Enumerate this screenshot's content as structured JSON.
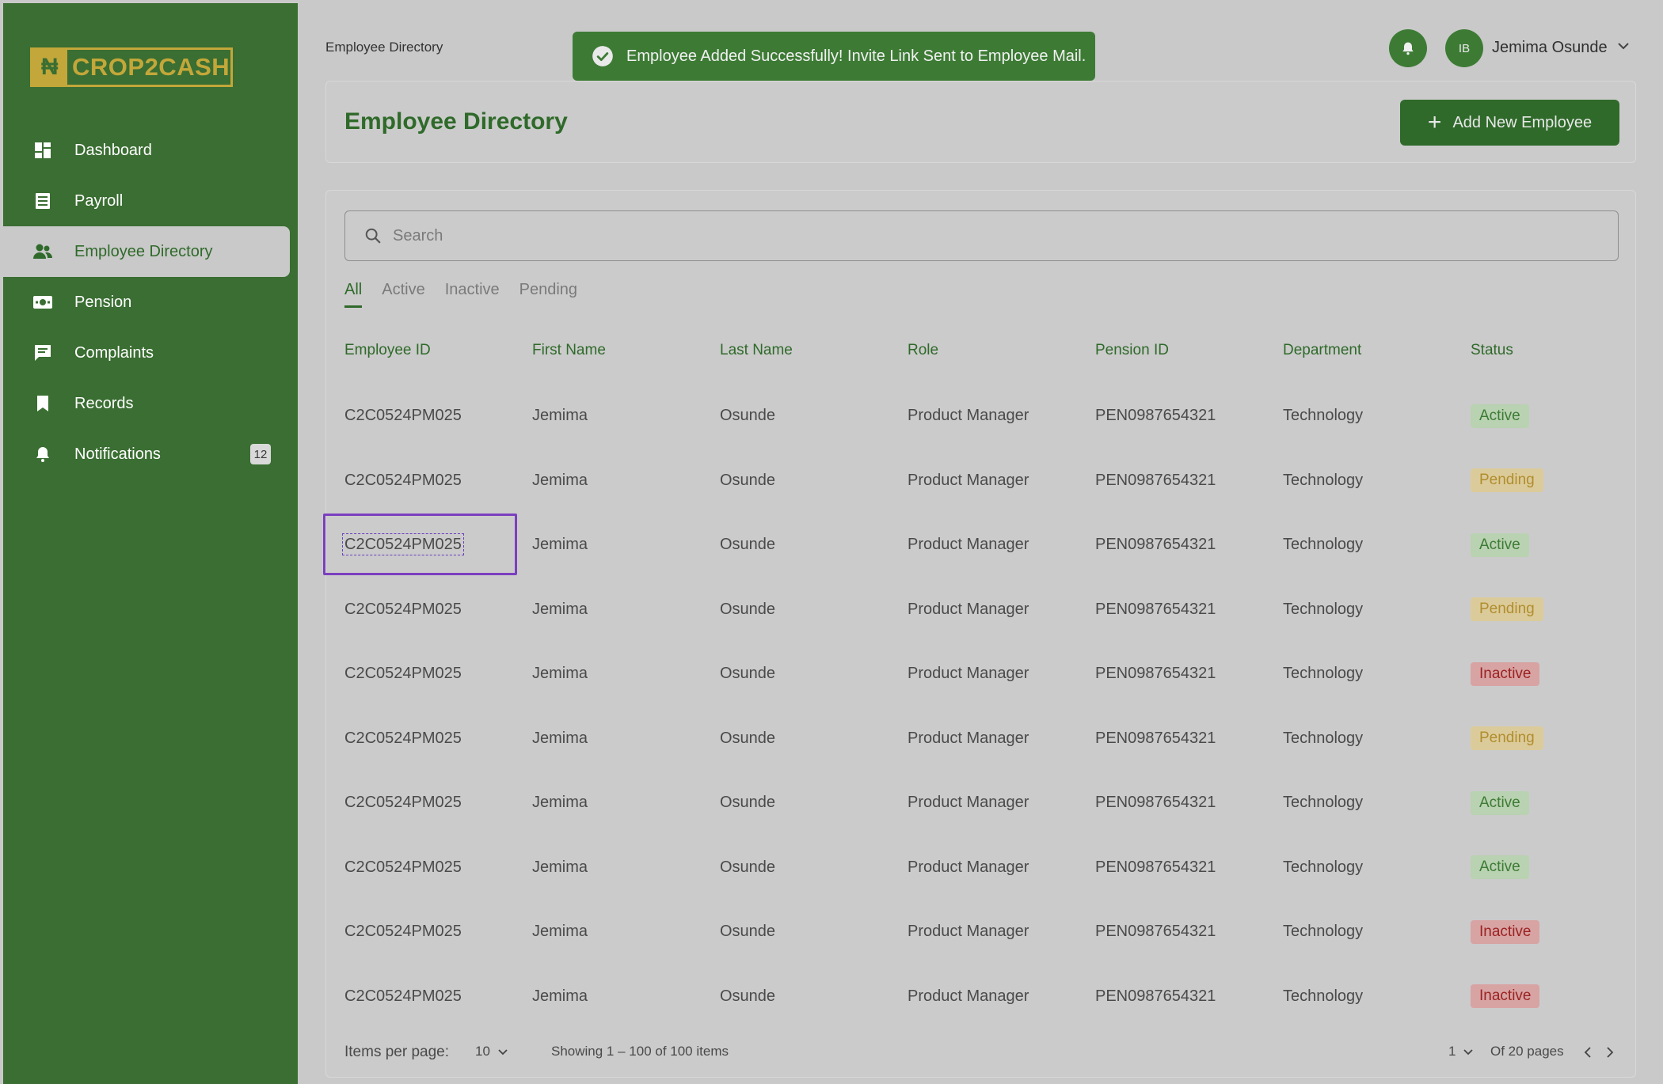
{
  "brand": {
    "logo_mark": "₦",
    "logo_text": "CROP2CASH"
  },
  "sidebar": {
    "items": [
      {
        "label": "Dashboard",
        "icon": "dashboard-icon"
      },
      {
        "label": "Payroll",
        "icon": "payroll-icon"
      },
      {
        "label": "Employee Directory",
        "icon": "users-icon",
        "active": true
      },
      {
        "label": "Pension",
        "icon": "pension-icon"
      },
      {
        "label": "Complaints",
        "icon": "complaints-icon"
      },
      {
        "label": "Records",
        "icon": "bookmark-icon"
      },
      {
        "label": "Notifications",
        "icon": "bell-icon",
        "badge": "12"
      }
    ]
  },
  "topbar": {
    "breadcrumb": "Employee Directory",
    "toast": "Employee Added Successfully! Invite Link Sent to Employee Mail.",
    "avatar_initials": "IB",
    "user_name": "Jemima Osunde"
  },
  "header": {
    "title": "Employee Directory",
    "add_button": "Add New Employee"
  },
  "search": {
    "placeholder": "Search"
  },
  "tabs": [
    "All",
    "Active",
    "Inactive",
    "Pending"
  ],
  "table": {
    "columns": [
      "Employee ID",
      "First Name",
      "Last Name",
      "Role",
      "Pension ID",
      "Department",
      "Status"
    ],
    "rows": [
      [
        "C2C0524PM025",
        "Jemima",
        "Osunde",
        "Product Manager",
        "PEN0987654321",
        "Technology",
        "Active"
      ],
      [
        "C2C0524PM025",
        "Jemima",
        "Osunde",
        "Product Manager",
        "PEN0987654321",
        "Technology",
        "Pending"
      ],
      [
        "C2C0524PM025",
        "Jemima",
        "Osunde",
        "Product Manager",
        "PEN0987654321",
        "Technology",
        "Active"
      ],
      [
        "C2C0524PM025",
        "Jemima",
        "Osunde",
        "Product Manager",
        "PEN0987654321",
        "Technology",
        "Pending"
      ],
      [
        "C2C0524PM025",
        "Jemima",
        "Osunde",
        "Product Manager",
        "PEN0987654321",
        "Technology",
        "Inactive"
      ],
      [
        "C2C0524PM025",
        "Jemima",
        "Osunde",
        "Product Manager",
        "PEN0987654321",
        "Technology",
        "Pending"
      ],
      [
        "C2C0524PM025",
        "Jemima",
        "Osunde",
        "Product Manager",
        "PEN0987654321",
        "Technology",
        "Active"
      ],
      [
        "C2C0524PM025",
        "Jemima",
        "Osunde",
        "Product Manager",
        "PEN0987654321",
        "Technology",
        "Active"
      ],
      [
        "C2C0524PM025",
        "Jemima",
        "Osunde",
        "Product Manager",
        "PEN0987654321",
        "Technology",
        "Inactive"
      ],
      [
        "C2C0524PM025",
        "Jemima",
        "Osunde",
        "Product Manager",
        "PEN0987654321",
        "Technology",
        "Inactive"
      ]
    ],
    "focused_row": 2
  },
  "footer": {
    "items_per_page_label": "Items per page:",
    "items_per_page": "10",
    "showing": "Showing 1 – 100 of 100 items",
    "current_page": "1",
    "page_total": "Of 20 pages"
  },
  "colors": {
    "primary": "#3a6e32",
    "active_badge": "#3d7b35",
    "pending_badge": "#b08d2e",
    "inactive_badge": "#9b2222",
    "focus_outline": "#7b3fbf"
  }
}
